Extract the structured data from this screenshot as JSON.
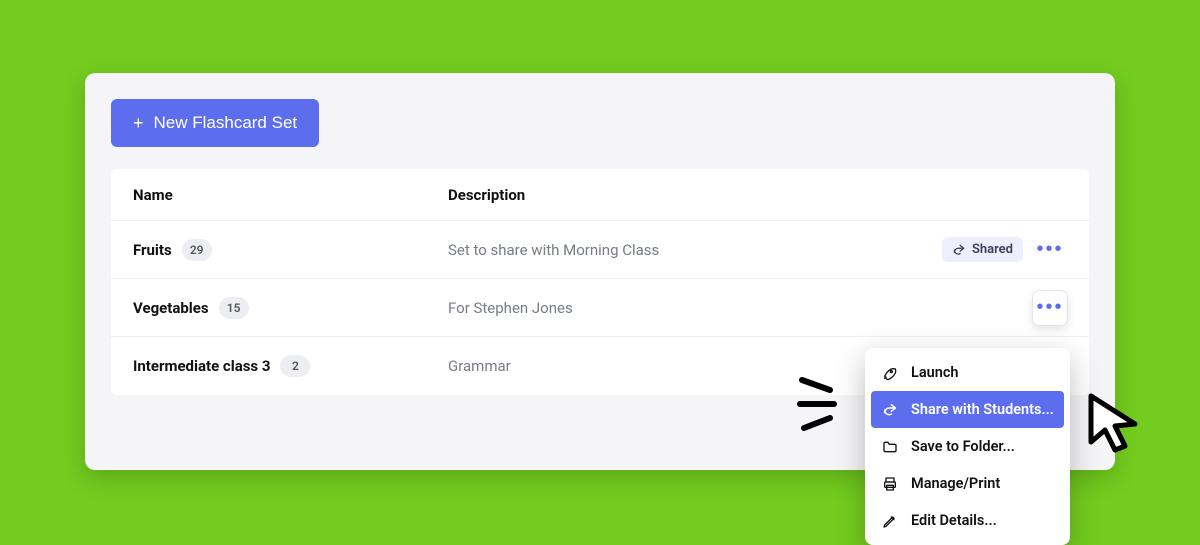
{
  "toolbar": {
    "new_set_label": "New Flashcard Set"
  },
  "table": {
    "headers": {
      "name": "Name",
      "description": "Description"
    },
    "rows": [
      {
        "name": "Fruits",
        "count": "29",
        "description": "Set to share with Morning Class",
        "shared_label": "Shared"
      },
      {
        "name": "Vegetables",
        "count": "15",
        "description": "For Stephen Jones"
      },
      {
        "name": "Intermediate class 3",
        "count": "2",
        "description": "Grammar"
      }
    ]
  },
  "dropdown": {
    "launch": "Launch",
    "share": "Share with Students...",
    "save_folder": "Save to Folder...",
    "manage_print": "Manage/Print",
    "edit_details": "Edit Details..."
  }
}
